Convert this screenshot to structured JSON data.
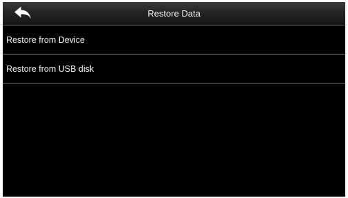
{
  "header": {
    "title": "Restore Data",
    "back_icon": "back-arrow-icon"
  },
  "menu": {
    "items": [
      {
        "label": "Restore from Device"
      },
      {
        "label": "Restore from USB disk"
      }
    ]
  },
  "colors": {
    "background": "#000000",
    "header_gradient_top": "#3a3a3a",
    "header_gradient_bottom": "#161616",
    "text": "#f2f2f2",
    "divider": "#7a7a7a"
  }
}
